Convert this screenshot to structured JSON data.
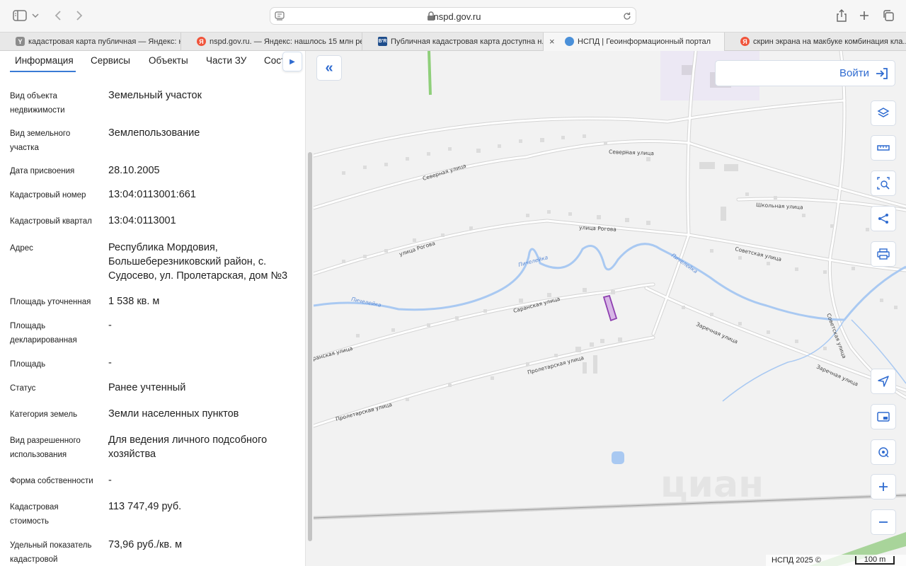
{
  "browser": {
    "url": "nspd.gov.ru",
    "tabs": [
      {
        "label": "кадастровая карта публичная — Яндекс: н...",
        "favicon": "Y",
        "favicon_color": "#8c8c8c"
      },
      {
        "label": "nspd.gov.ru. — Яндекс: нашлось 15 млн ре...",
        "favicon": "Я",
        "favicon_color": "#f0543b"
      },
      {
        "label": "Публичная кадастровая карта доступна н...",
        "favicon": "B'R",
        "favicon_color": "#1f4e8c"
      },
      {
        "label": "НСПД | Геоинформационный портал",
        "favicon": "globe",
        "favicon_color": "#4a90d9",
        "active": true
      },
      {
        "label": "скрин экрана на макбуке комбинация кла...",
        "favicon": "Я",
        "favicon_color": "#f0543b"
      }
    ]
  },
  "sidebar": {
    "tabs": [
      "Информация",
      "Сервисы",
      "Объекты",
      "Части ЗУ",
      "Состав"
    ],
    "active_tab": "Информация",
    "rows": [
      {
        "label": "Вид объекта недвижимости",
        "value": "Земельный участок"
      },
      {
        "label": "Вид земельного участка",
        "value": "Землепользование"
      },
      {
        "label": "Дата присвоения",
        "value": "28.10.2005"
      },
      {
        "label": "Кадастровый номер",
        "value": "13:04:0113001:661"
      },
      {
        "label": "Кадастровый квартал",
        "value": "13:04:0113001"
      },
      {
        "label": "Адрес",
        "value": "Республика Мордовия, Большеберезниковский район, с. Судосево, ул. Пролетарская, дом №3"
      },
      {
        "label": "Площадь уточненная",
        "value": "1 538 кв. м"
      },
      {
        "label": "Площадь декларированная",
        "value": "-"
      },
      {
        "label": "Площадь",
        "value": "-"
      },
      {
        "label": "Статус",
        "value": "Ранее учтенный"
      },
      {
        "label": "Категория земель",
        "value": "Земли населенных пунктов"
      },
      {
        "label": "Вид разрешенного использования",
        "value": "Для ведения личного подсобного хозяйства"
      },
      {
        "label": "Форма собственности",
        "value": "-"
      },
      {
        "label": "Кадастровая стоимость",
        "value": "113 747,49 руб."
      },
      {
        "label": "Удельный показатель кадастровой",
        "value": "73,96 руб./кв. м"
      }
    ]
  },
  "map": {
    "login_label": "Войти",
    "footer_copyright": "НСПД 2025 ©",
    "scale_label": "100 m",
    "watermark": "циан",
    "streets": [
      "Северная улица",
      "Северная улица",
      "улица Рогова",
      "улица Рогова",
      "Школьная улица",
      "Советская улица",
      "Советская улица",
      "Саранская улица",
      "Саранская улица",
      "Пролетарская улица",
      "Пролетарская улица",
      "Заречная улица",
      "Заречная улица",
      "Пичелейка",
      "Пичелейка",
      "Пичелейка"
    ],
    "accent_color": "#2f6bd0",
    "parcel_color": "#8e3fb0"
  }
}
